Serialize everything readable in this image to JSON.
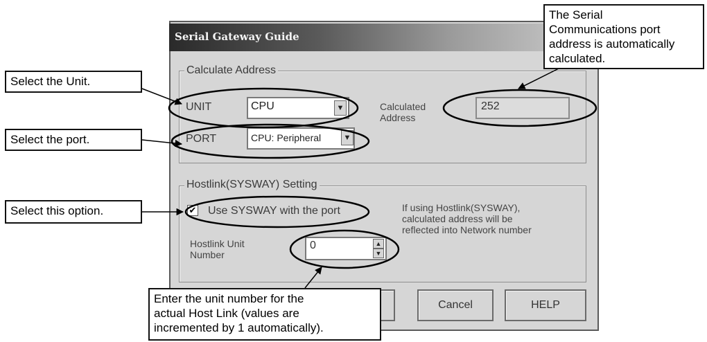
{
  "dialog": {
    "title": "Serial Gateway Guide",
    "calc_group": {
      "legend": "Calculate Address",
      "unit_label": "UNIT",
      "unit_value": "CPU",
      "port_label": "PORT",
      "port_value": "CPU: Peripheral",
      "calc_label_line1": "Calculated",
      "calc_label_line2": "Address",
      "calc_value": "252"
    },
    "hostlink_group": {
      "legend": "Hostlink(SYSWAY) Setting",
      "checkbox_label": "Use SYSWAY with the port",
      "checkbox_checked": true,
      "unit_number_label_line1": "Hostlink Unit",
      "unit_number_label_line2": "Number",
      "unit_number_value": "0",
      "info_line1": "If using Hostlink(SYSWAY),",
      "info_line2": "calculated address will be",
      "info_line3": "reflected into Network number"
    },
    "buttons": {
      "cancel": "Cancel",
      "help": "HELP"
    }
  },
  "callouts": {
    "unit": "Select the Unit.",
    "port": "Select the port.",
    "option": "Select this option.",
    "address": [
      "The Serial",
      "Communications port",
      "address is automatically",
      "calculated."
    ],
    "unit_number": [
      "Enter the unit number for the",
      "actual Host Link (values are",
      "incremented by 1 automatically)."
    ]
  }
}
